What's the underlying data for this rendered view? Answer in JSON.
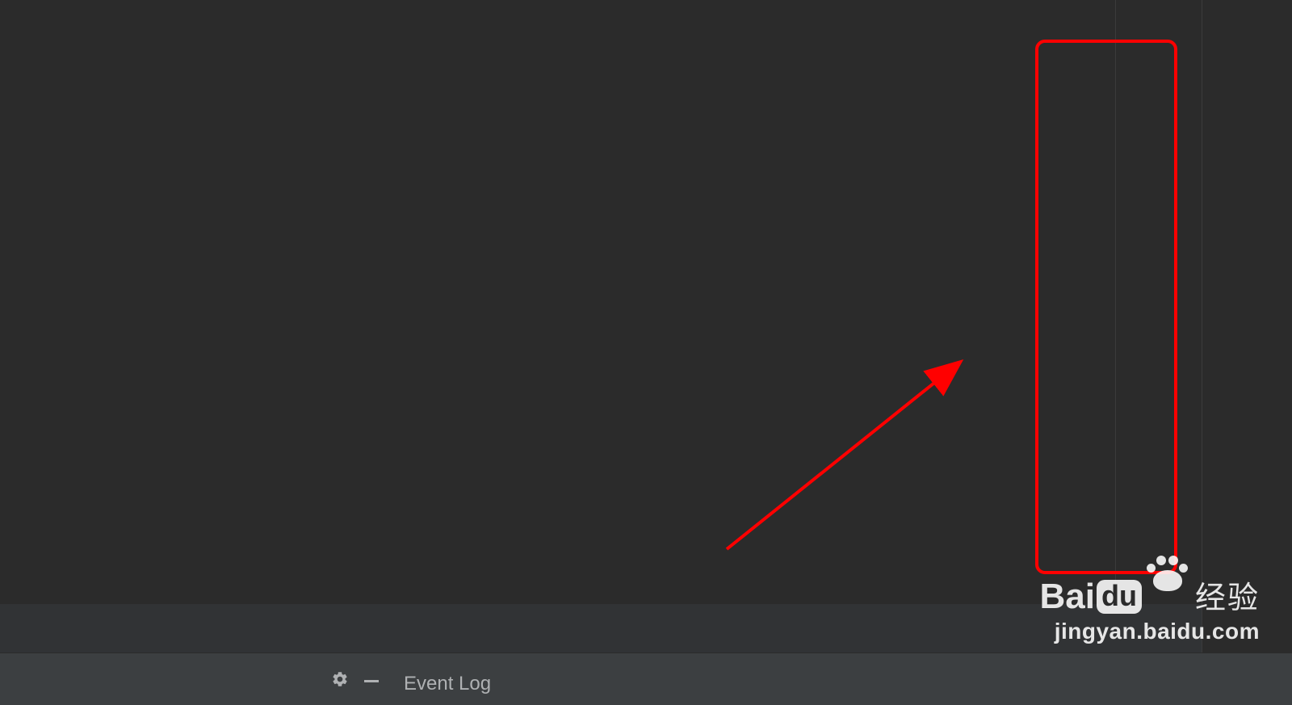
{
  "bottom_bar": {
    "event_log_label": "Event Log"
  },
  "watermark": {
    "brand_b": "Bai",
    "brand_du": "du",
    "brand_cn": "经验",
    "url": "jingyan.baidu.com"
  },
  "annotation": {
    "box_color": "#ff0000",
    "arrow_color": "#ff0000"
  }
}
